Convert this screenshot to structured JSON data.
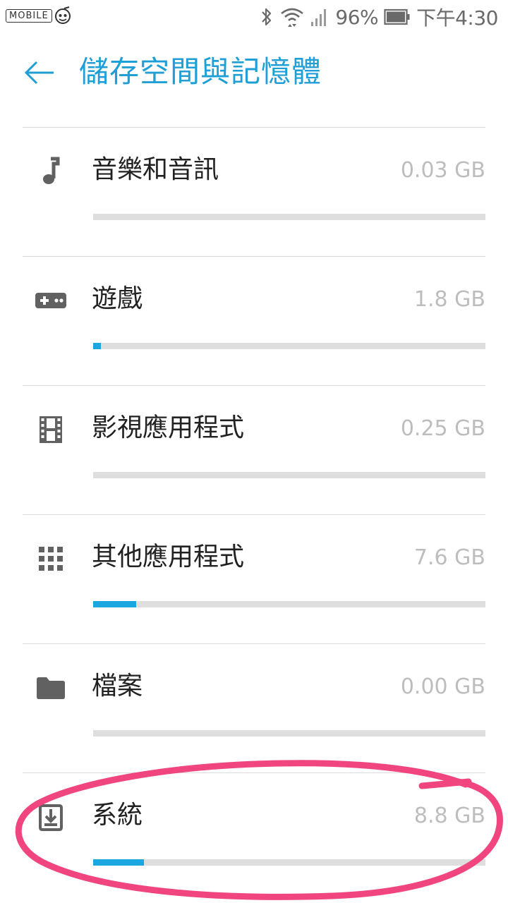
{
  "status_bar": {
    "watermark": "MOBILE",
    "battery_percent": "96%",
    "time": "下午4:30",
    "icons": [
      "bluetooth-icon",
      "wifi-icon",
      "signal-icon",
      "battery-icon"
    ]
  },
  "header": {
    "back_icon": "arrow-left-icon",
    "title": "儲存空間與記憶體"
  },
  "items": [
    {
      "id": "music",
      "icon": "music-note-icon",
      "label": "音樂和音訊",
      "size": "0.03 GB",
      "fill": 0.0
    },
    {
      "id": "games",
      "icon": "gamepad-icon",
      "label": "遊戲",
      "size": "1.8 GB",
      "fill": 0.02
    },
    {
      "id": "video",
      "icon": "film-icon",
      "label": "影視應用程式",
      "size": "0.25 GB",
      "fill": 0.0
    },
    {
      "id": "other-apps",
      "icon": "apps-grid-icon",
      "label": "其他應用程式",
      "size": "7.6 GB",
      "fill": 0.11
    },
    {
      "id": "files",
      "icon": "folder-icon",
      "label": "檔案",
      "size": "0.00 GB",
      "fill": 0.0
    },
    {
      "id": "system",
      "icon": "system-download-icon",
      "label": "系統",
      "size": "8.8 GB",
      "fill": 0.13
    }
  ],
  "colors": {
    "accent": "#1f9fd6",
    "bar_fill": "#1aa7e0",
    "bar_track": "#dedede",
    "annotation": "#f0457e"
  }
}
